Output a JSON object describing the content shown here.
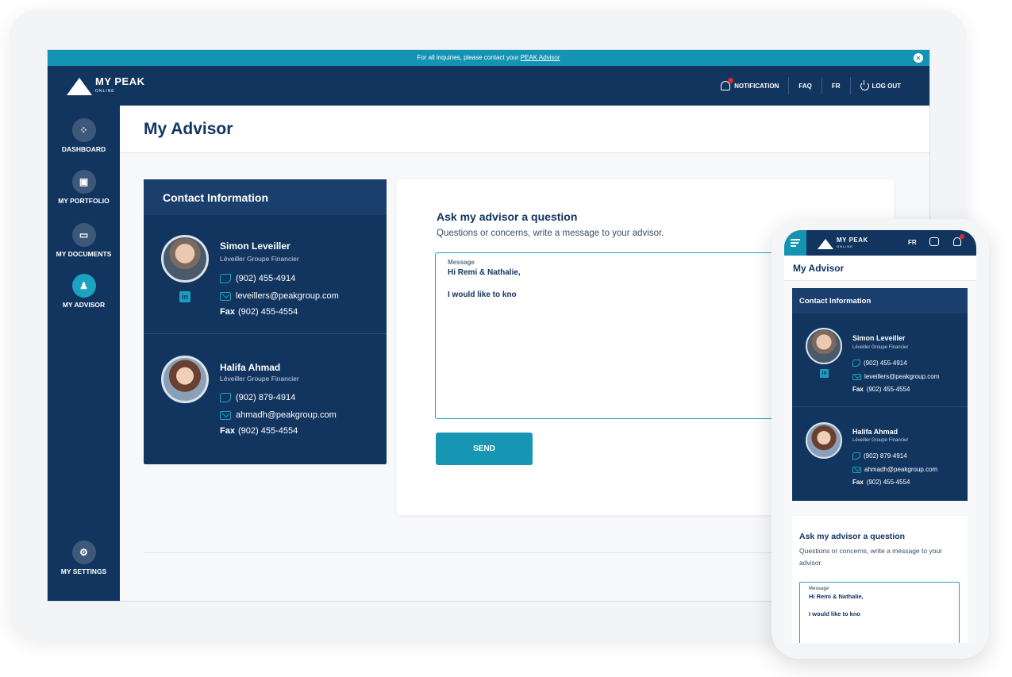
{
  "banner": {
    "text": "For all inquiries, please contact your ",
    "link": "PEAK Advisor"
  },
  "brand": {
    "name": "MY PEAK",
    "sub": "ONLINE"
  },
  "header": {
    "notification": "NOTIFICATION",
    "faq": "FAQ",
    "lang": "FR",
    "logout": "LOG OUT"
  },
  "sidebar": {
    "items": [
      {
        "label": "DASHBOARD"
      },
      {
        "label": "MY PORTFOLIO"
      },
      {
        "label": "MY DOCUMENTS"
      },
      {
        "label": "MY ADVISOR"
      }
    ],
    "settings": "MY SETTINGS"
  },
  "page": {
    "title": "My Advisor"
  },
  "contact": {
    "title": "Contact Information",
    "people": [
      {
        "name": "Simon Leveiller",
        "firm": "Léveiller Groupe Financier",
        "phone": "(902) 455-4914",
        "email": "leveillers@peakgroup.com",
        "fax_label": "Fax",
        "fax": "(902) 455-4554"
      },
      {
        "name": "Halifa Ahmad",
        "firm": "Léveiller Groupe Financier",
        "phone": "(902) 879-4914",
        "email": "ahmadh@peakgroup.com",
        "fax_label": "Fax",
        "fax": "(902) 455-4554"
      }
    ]
  },
  "ask": {
    "title": "Ask my advisor a question",
    "subtitle": "Questions or concerns, write a message to your advisor.",
    "message_label": "Message",
    "message_value": "Hi Remi & Nathalie,\n\nI would like to kno",
    "send": "SEND"
  },
  "mobile": {
    "lang": "FR",
    "title": "My Advisor",
    "contact_title": "Contact Information",
    "people": [
      {
        "name": "Simon Leveiller",
        "firm": "Léveiller Groupe Financier",
        "phone": "(902) 455-4914",
        "email": "leveillers@peakgroup.com",
        "fax_label": "Fax",
        "fax": "(902) 455-4554"
      },
      {
        "name": "Halifa Ahmad",
        "firm": "Léveiller Groupe Financier",
        "phone": "(902) 879-4914",
        "email": "ahmadh@peakgroup.com",
        "fax_label": "Fax",
        "fax": "(902) 455-4554"
      }
    ],
    "ask_title": "Ask my advisor a question",
    "ask_subtitle": "Questions or concerns, write a message to your advisor.",
    "message_label": "Message",
    "message_value": "Hi Remi & Nathalie,\n\nI would like to kno"
  },
  "colors": {
    "navy": "#123560",
    "accent": "#1796b4",
    "alert": "#e02a2a"
  }
}
